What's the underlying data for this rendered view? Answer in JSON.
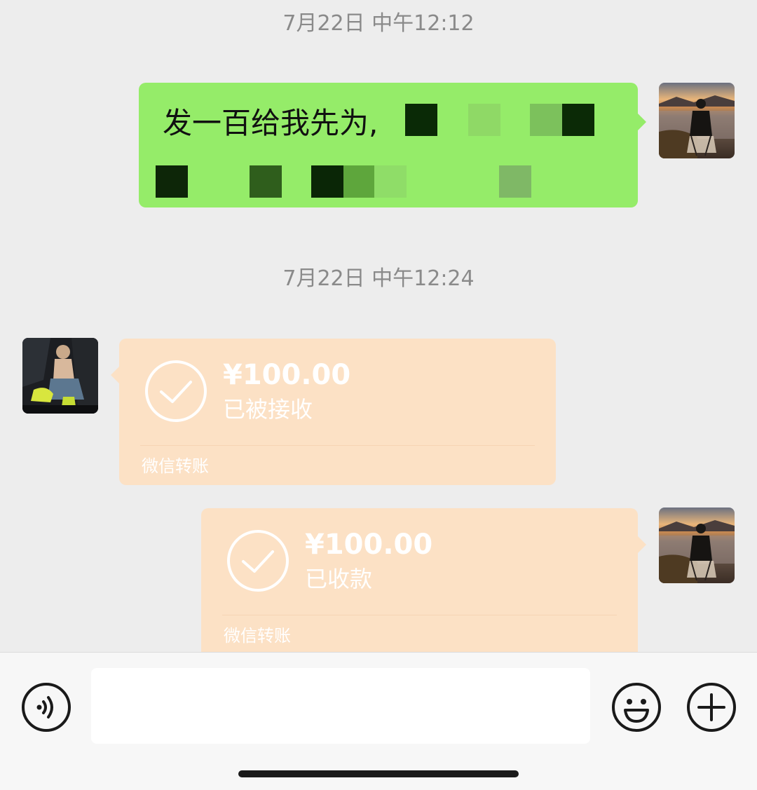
{
  "chat": {
    "timestamps": [
      "7月22日 中午12:12",
      "7月22日 中午12:24"
    ],
    "sent_message": {
      "text": "发一百给我先为,"
    },
    "transfers": [
      {
        "amount": "¥100.00",
        "status": "已被接收",
        "label": "微信转账",
        "direction": "received"
      },
      {
        "amount": "¥100.00",
        "status": "已收款",
        "label": "微信转账",
        "direction": "sent"
      }
    ]
  },
  "input_bar": {
    "voice_icon": "voice-icon",
    "emoji_icon": "emoji-icon",
    "plus_icon": "plus-icon",
    "input_value": ""
  },
  "colors": {
    "background": "#ededed",
    "sent_bubble": "#95ec69",
    "transfer_bubble": "#fce1c5"
  }
}
